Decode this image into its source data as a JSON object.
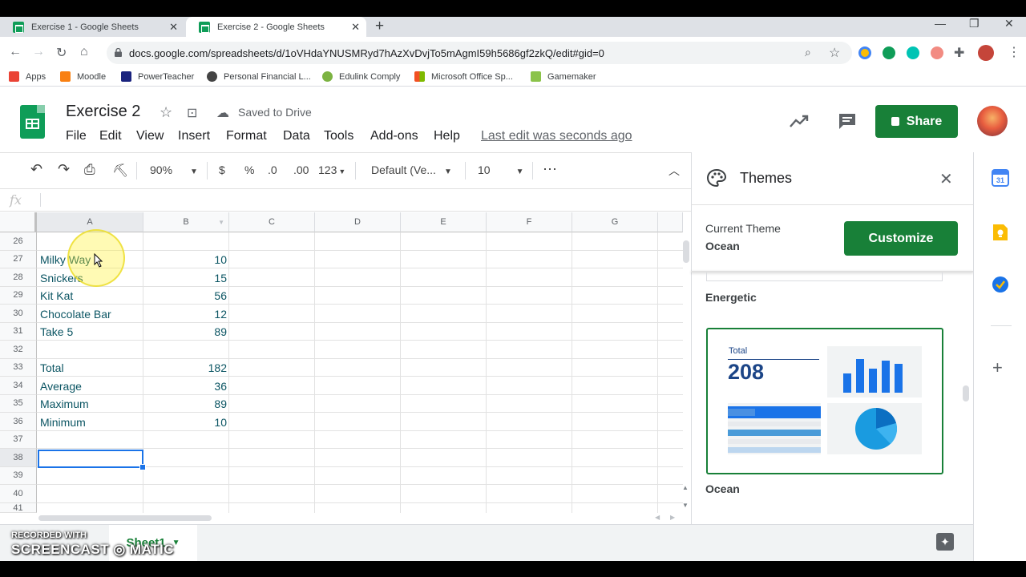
{
  "browser": {
    "tabs": [
      {
        "title": "Exercise 1 - Google Sheets"
      },
      {
        "title": "Exercise 2 - Google Sheets"
      }
    ],
    "new_tab": "+",
    "url": "docs.google.com/spreadsheets/d/1oVHdaYNUSMRyd7hAzXvDvjTo5mAgmI59h5686gf2zkQ/edit#gid=0",
    "bookmarks": [
      {
        "label": "Apps",
        "color": "#ea4335"
      },
      {
        "label": "Moodle",
        "color": "#f98012"
      },
      {
        "label": "PowerTeacher",
        "color": "#1a237e"
      },
      {
        "label": "Personal Financial L...",
        "color": "#444444"
      },
      {
        "label": "Edulink Comply",
        "color": "#7cb342"
      },
      {
        "label": "Microsoft Office Sp...",
        "color": "#f25022"
      },
      {
        "label": "Gamemaker",
        "color": "#8bc34a"
      }
    ]
  },
  "doc": {
    "title": "Exercise 2",
    "saved": "Saved to Drive",
    "menu": [
      "File",
      "Edit",
      "View",
      "Insert",
      "Format",
      "Data",
      "Tools",
      "Add-ons",
      "Help"
    ],
    "last_edit": "Last edit was seconds ago",
    "share": "Share"
  },
  "toolbar": {
    "zoom": "90%",
    "currency": "$",
    "percent": "%",
    "dec_less": ".0",
    "dec_more": ".00",
    "more_formats": "123",
    "font": "Default (Ve...",
    "font_size": "10",
    "more": "⋯"
  },
  "formula_bar": {
    "fx": "fx"
  },
  "grid": {
    "columns": [
      "A",
      "B",
      "C",
      "D",
      "E",
      "F",
      "G"
    ],
    "rows": [
      {
        "num": "26",
        "a": "",
        "b": ""
      },
      {
        "num": "27",
        "a": "Milky Way",
        "b": "10"
      },
      {
        "num": "28",
        "a": "Snickers",
        "b": "15"
      },
      {
        "num": "29",
        "a": "Kit Kat",
        "b": "56"
      },
      {
        "num": "30",
        "a": "Chocolate Bar",
        "b": "12"
      },
      {
        "num": "31",
        "a": "Take 5",
        "b": "89"
      },
      {
        "num": "32",
        "a": "",
        "b": ""
      },
      {
        "num": "33",
        "a": "Total",
        "b": "182"
      },
      {
        "num": "34",
        "a": "Average",
        "b": "36"
      },
      {
        "num": "35",
        "a": "Maximum",
        "b": "89"
      },
      {
        "num": "36",
        "a": "Minimum",
        "b": "10"
      },
      {
        "num": "37",
        "a": "",
        "b": ""
      },
      {
        "num": "38",
        "a": "",
        "b": ""
      },
      {
        "num": "39",
        "a": "",
        "b": ""
      },
      {
        "num": "40",
        "a": "",
        "b": ""
      },
      {
        "num": "41",
        "a": "",
        "b": ""
      }
    ],
    "selected_cell": "A38"
  },
  "sheet_tab": "Sheet1",
  "watermark": {
    "line1": "RECORDED WITH",
    "line2": "SCREENCAST ◎ MATIC"
  },
  "themes_panel": {
    "title": "Themes",
    "current_label": "Current Theme",
    "current_name": "Ocean",
    "customize": "Customize",
    "themes": [
      "Energetic",
      "Ocean"
    ],
    "preview_total_label": "Total",
    "preview_total_value": "208"
  },
  "colors": {
    "accent": "#188038",
    "text": "#0b5563",
    "selection": "#1a73e8",
    "preview_dark": "#1c4587",
    "preview_blue": "#1a73e8"
  }
}
